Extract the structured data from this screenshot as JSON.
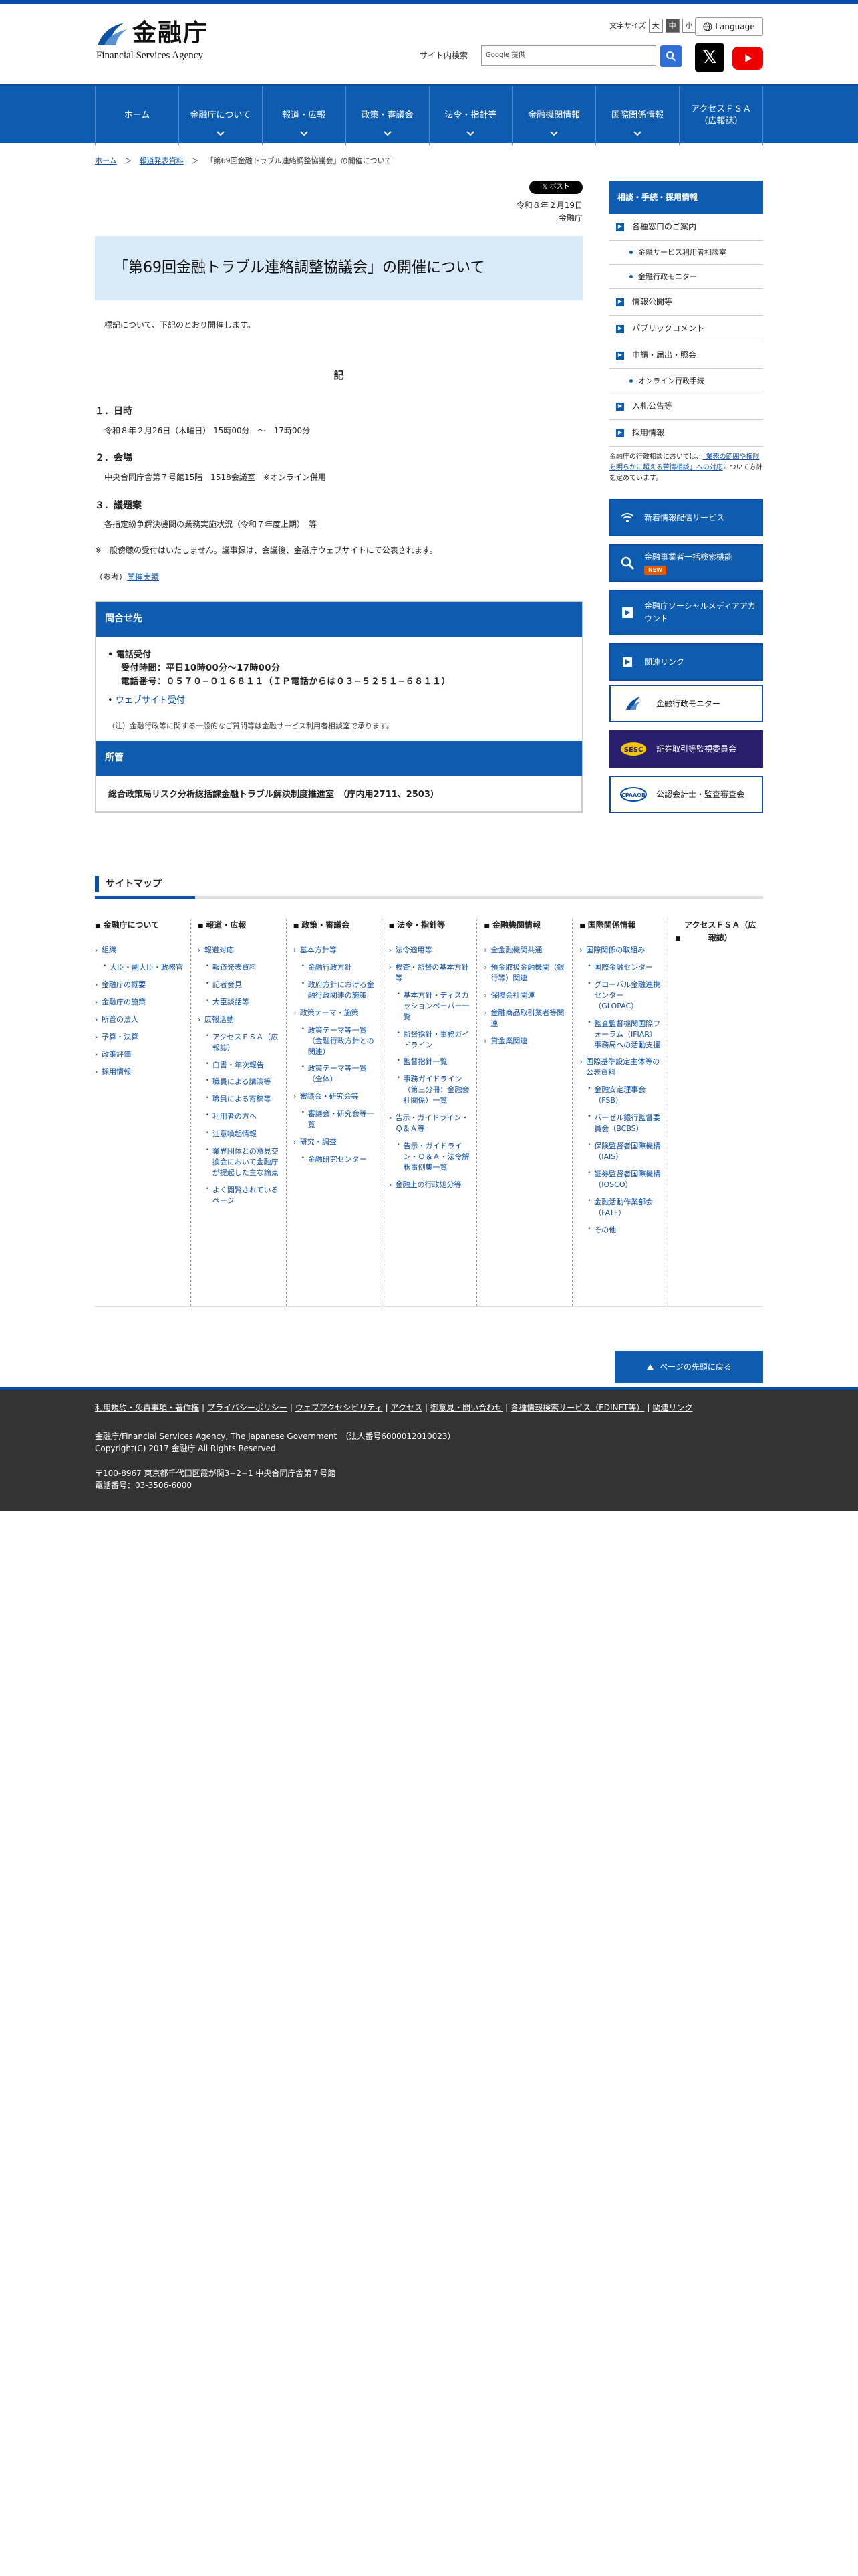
{
  "header": {
    "logo_jp": "金融庁",
    "logo_en": "Financial Services Agency",
    "font_size_label": "文字サイズ",
    "font_sizes": [
      "大",
      "中",
      "小"
    ],
    "language_label": "Language",
    "search_label": "サイト内検索",
    "search_placeholder": "Google 提供",
    "x_label": "𝕏"
  },
  "gnav": [
    "ホーム",
    "金融庁について",
    "報道・広報",
    "政策・審議会",
    "法令・指針等",
    "金融機関情報",
    "国際関係情報",
    "アクセスＦＳＡ\n（広報誌）"
  ],
  "breadcrumb": {
    "items": [
      "ホーム",
      "報道発表資料",
      "「第69回金融トラブル連絡調整協議会」の開催について"
    ],
    "sep": "＞"
  },
  "article": {
    "post_label": "𝕏 ポスト",
    "date": "令和８年２月19日",
    "org": "金融庁",
    "title": "「第69回金融トラブル連絡調整協議会」の開催について",
    "lead": "標記について、下記のとおり開催します。",
    "ki": "記",
    "sec1_h": "１．日時",
    "sec1_b": "令和８年２月26日（木曜日） 15時00分　〜　17時00分",
    "sec2_h": "２．会場",
    "sec2_b": "中央合同庁舎第７号館15階　1518会議室　※オンライン併用",
    "sec3_h": "３．議題案",
    "sec3_b": "各指定紛争解決機関の業務実施状況（令和７年度上期）　等",
    "notice": "※一般傍聴の受付はいたしません。議事録は、会議後、金融庁ウェブサイトにて公表されます。",
    "ref_prefix": "（参考）",
    "ref_link": "開催実績"
  },
  "contact": {
    "heading": "問合せ先",
    "phone_label": "電話受付",
    "hours": "受付時間：平日10時00分〜17時00分",
    "phone": "電話番号：０５７０−０１６８１１（ＩＰ電話からは０３−５２５１−６８１１）",
    "web_label": "ウェブサイト受付",
    "note": "（注）金融行政等に関する一般的なご質問等は金融サービス利用者相談室で承ります。"
  },
  "department": {
    "heading": "所管",
    "body": "総合政策局リスク分析総括課金融トラブル解決制度推進室　（庁内用2711、2503）"
  },
  "sidebar": {
    "heading": "相談・手続・採用情報",
    "items": [
      {
        "label": "各種窓口のご案内",
        "sub": false
      },
      {
        "label": "金融サービス利用者相談室",
        "sub": true
      },
      {
        "label": "金融行政モニター",
        "sub": true
      },
      {
        "label": "情報公開等",
        "sub": false
      },
      {
        "label": "パブリックコメント",
        "sub": false
      },
      {
        "label": "申請・届出・照会",
        "sub": false
      },
      {
        "label": "オンライン行政手続",
        "sub": true
      },
      {
        "label": "入札公告等",
        "sub": false
      },
      {
        "label": "採用情報",
        "sub": false
      }
    ],
    "note_pre": "金融庁の行政相談においては、",
    "note_link": "「業務の範囲や権限を明らかに超える苦情相談」への対応",
    "note_post": "について方針を定めています。",
    "banners": [
      {
        "label": "新着情報配信サービス",
        "icon": "wifi-icon"
      },
      {
        "label": "金融事業者一括検索機能",
        "icon": "search-icon",
        "badge": "NEW"
      },
      {
        "label": "金融庁ソーシャルメディアアカウント",
        "icon": "share-icon"
      },
      {
        "label": "関連リンク",
        "icon": "link-icon"
      },
      {
        "label": "金融行政モニター",
        "icon": "logo-icon"
      },
      {
        "label": "証券取引等監視委員会",
        "icon": "sesc-logo"
      },
      {
        "label": "公認会計士・監査審査会",
        "icon": "cpaaob-logo"
      }
    ]
  },
  "sitemap": {
    "title": "サイトマップ",
    "cols": [
      {
        "h": "金融庁について",
        "items": [
          [
            "組織",
            0
          ],
          [
            "大臣・副大臣・政務官",
            1
          ],
          [
            "金融庁の概要",
            0
          ],
          [
            "金融庁の施策",
            0
          ],
          [
            "所管の法人",
            0
          ],
          [
            "予算・決算",
            0
          ],
          [
            "政策評価",
            0
          ],
          [
            "採用情報",
            0
          ]
        ]
      },
      {
        "h": "報道・広報",
        "items": [
          [
            "報道対応",
            0
          ],
          [
            "報道発表資料",
            1
          ],
          [
            "記者会見",
            1
          ],
          [
            "大臣談話等",
            1
          ],
          [
            "広報活動",
            0
          ],
          [
            "アクセスＦＳＡ（広報誌）",
            1
          ],
          [
            "白書・年次報告",
            1
          ],
          [
            "職員による講演等",
            1
          ],
          [
            "職員による寄稿等",
            1
          ],
          [
            "利用者の方へ",
            1
          ],
          [
            "注意喚起情報",
            1
          ],
          [
            "業界団体との意見交換会において金融庁が提起した主な論点",
            1
          ],
          [
            "よく閲覧されているページ",
            1
          ]
        ]
      },
      {
        "h": "政策・審議会",
        "items": [
          [
            "基本方針等",
            0
          ],
          [
            "金融行政方針",
            1
          ],
          [
            "政府方針における金融行政関連の施策",
            1
          ],
          [
            "政策テーマ・施策",
            0
          ],
          [
            "政策テーマ等一覧（金融行政方針との関連）",
            1
          ],
          [
            "政策テーマ等一覧（全体）",
            1
          ],
          [
            "審議会・研究会等",
            0
          ],
          [
            "審議会・研究会等一覧",
            1
          ],
          [
            "研究・調査",
            0
          ],
          [
            "金融研究センター",
            1
          ]
        ]
      },
      {
        "h": "法令・指針等",
        "items": [
          [
            "法令適用等",
            0
          ],
          [
            "検査・監督の基本方針等",
            0
          ],
          [
            "基本方針・ディスカッションペーパー一覧",
            1
          ],
          [
            "監督指針・事務ガイドライン",
            1
          ],
          [
            "監督指針一覧",
            1
          ],
          [
            "事務ガイドライン（第三分冊：金融会社関係）一覧",
            1
          ],
          [
            "告示・ガイドライン・Ｑ＆Ａ等",
            0
          ],
          [
            "告示・ガイドライン・Ｑ＆Ａ・法令解釈事例集一覧",
            1
          ],
          [
            "金融上の行政処分等",
            0
          ]
        ]
      },
      {
        "h": "金融機関情報",
        "items": [
          [
            "全金融機関共通",
            0
          ],
          [
            "預金取扱金融機関（銀行等）関連",
            0
          ],
          [
            "保険会社関連",
            0
          ],
          [
            "金融商品取引業者等関連",
            0
          ],
          [
            "貸金業関連",
            0
          ]
        ]
      },
      {
        "h": "国際関係情報",
        "items": [
          [
            "国際関係の取組み",
            0
          ],
          [
            "国際金融センター",
            1
          ],
          [
            "グローバル金融連携センター（GLOPAC）",
            1
          ],
          [
            "監査監督機関国際フォーラム（IFIAR）事務局への活動支援",
            1
          ],
          [
            "国際基準設定主体等の公表資料",
            0
          ],
          [
            "金融安定理事会（FSB）",
            1
          ],
          [
            "バーゼル銀行監督委員会（BCBS）",
            1
          ],
          [
            "保険監督者国際機構（IAIS）",
            1
          ],
          [
            "証券監督者国際機構（IOSCO）",
            1
          ],
          [
            "金融活動作業部会（FATF）",
            1
          ],
          [
            "その他",
            1
          ]
        ]
      },
      {
        "h": "アクセスＦＳＡ（広報誌）",
        "items": []
      }
    ]
  },
  "pagetop": "ページの先頭に戻る",
  "footer": {
    "links": [
      "利用規約・免責事項・著作権",
      "プライバシーポリシー",
      "ウェブアクセシビリティ",
      "アクセス",
      "御意見・問い合わせ",
      "各種情報検索サービス（EDINET等）",
      "関連リンク"
    ],
    "line1": "金融庁/Financial Services Agency, The Japanese Government　（法人番号6000012010023）",
    "line2": "Copyright(C) 2017 金融庁 All Rights Reserved.",
    "line3": "〒100-8967 東京都千代田区霞が関3−2−1 中央合同庁舎第７号館",
    "line4": "電話番号：03-3506-6000"
  }
}
